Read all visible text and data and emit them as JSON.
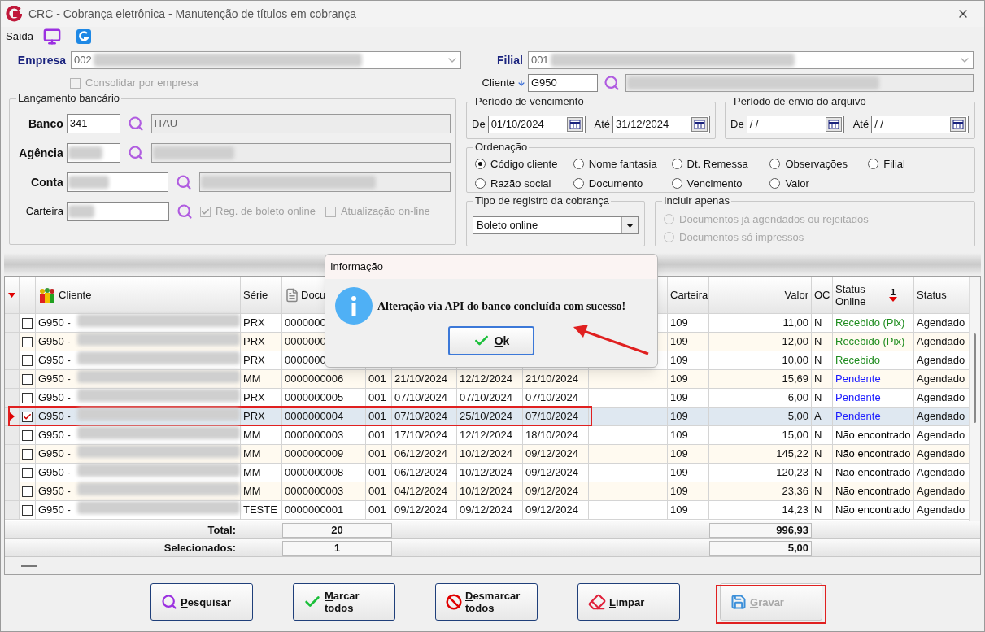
{
  "window": {
    "title": "CRC - Cobrança eletrônica - Manutenção de títulos em cobrança"
  },
  "menu": {
    "label": "Saída"
  },
  "empresa": {
    "label": "Empresa",
    "value": "002"
  },
  "consolidar": {
    "label": "Consolidar por empresa",
    "checked": false,
    "disabled": true
  },
  "filial": {
    "label": "Filial",
    "value": "001"
  },
  "cliente": {
    "label": "Cliente",
    "value": "G950"
  },
  "lancamento": {
    "title": "Lançamento bancário",
    "banco": {
      "label": "Banco",
      "value": "341",
      "name": "ITAU"
    },
    "agencia": {
      "label": "Agência"
    },
    "conta": {
      "label": "Conta"
    },
    "carteira": {
      "label": "Carteira"
    },
    "options": [
      {
        "label": "Reg. de boleto online",
        "checked": true,
        "disabled": true
      },
      {
        "label": "Atualização on-line",
        "checked": false,
        "disabled": true
      }
    ]
  },
  "vencimento": {
    "title": "Período de vencimento",
    "from_label": "De",
    "from": "01/10/2024",
    "to_label": "Até",
    "to": "31/12/2024"
  },
  "envio": {
    "title": "Período de envio do arquivo",
    "from_label": "De",
    "from": "/ /",
    "to_label": "Até",
    "to": "/ /"
  },
  "ordenacao": {
    "title": "Ordenação",
    "options": [
      {
        "label": "Código cliente",
        "selected": true
      },
      {
        "label": "Nome fantasia",
        "selected": false
      },
      {
        "label": "Dt. Remessa",
        "selected": false
      },
      {
        "label": "Observações",
        "selected": false
      },
      {
        "label": "Filial",
        "selected": false
      },
      {
        "label": "Razão social",
        "selected": false
      },
      {
        "label": "Documento",
        "selected": false
      },
      {
        "label": "Vencimento",
        "selected": false
      },
      {
        "label": "Valor",
        "selected": false
      }
    ]
  },
  "tipo_registro": {
    "title": "Tipo de registro da cobrança",
    "value": "Boleto online"
  },
  "incluir": {
    "title": "Incluir apenas",
    "options": [
      {
        "label": "Documentos já agendados ou rejeitados",
        "selected": false,
        "disabled": true
      },
      {
        "label": "Documentos só impressos",
        "selected": false,
        "disabled": true
      }
    ]
  },
  "table": {
    "columns": [
      {
        "label": "Cliente"
      },
      {
        "label": "Série"
      },
      {
        "label": "Docu"
      },
      {},
      {},
      {},
      {},
      {},
      {
        "label": "Carteira"
      },
      {
        "label": "Valor"
      },
      {
        "label": "OC"
      },
      {
        "label": "Status Online",
        "sort_order": "1"
      },
      {
        "label": "Status"
      }
    ],
    "rows": [
      {
        "checked": false,
        "selected": false,
        "cliente": "G950 -",
        "serie": "PRX",
        "documento": "0000000",
        "carteira": "109",
        "valor": "11,00",
        "oc": "N",
        "status_online": "Recebido (Pix)",
        "color": "#1e8c1e",
        "status": "Agendado"
      },
      {
        "checked": false,
        "selected": false,
        "cliente": "G950 -",
        "serie": "PRX",
        "documento": "0000000",
        "carteira": "109",
        "valor": "12,00",
        "oc": "N",
        "status_online": "Recebido (Pix)",
        "color": "#1e8c1e",
        "status": "Agendado"
      },
      {
        "checked": false,
        "selected": false,
        "cliente": "G950 -",
        "serie": "PRX",
        "documento": "0000000",
        "carteira": "109",
        "valor": "10,00",
        "oc": "N",
        "status_online": "Recebido",
        "color": "#1e8c1e",
        "status": "Agendado"
      },
      {
        "checked": false,
        "selected": false,
        "cliente": "G950 -",
        "serie": "MM",
        "documento": "0000000006",
        "column_6": "001",
        "column_7": "21/10/2024",
        "column_8": "12/12/2024",
        "column_9": "21/10/2024",
        "carteira": "109",
        "valor": "15,69",
        "oc": "N",
        "status_online": "Pendente",
        "color": "#1a1aff",
        "status": "Agendado"
      },
      {
        "checked": false,
        "selected": false,
        "cliente": "G950 -",
        "serie": "PRX",
        "documento": "0000000005",
        "column_6": "001",
        "column_7": "07/10/2024",
        "column_8": "07/10/2024",
        "column_9": "07/10/2024",
        "carteira": "109",
        "valor": "6,00",
        "oc": "N",
        "status_online": "Pendente",
        "color": "#1a1aff",
        "status": "Agendado"
      },
      {
        "checked": true,
        "selected": true,
        "cliente": "G950 -",
        "serie": "PRX",
        "documento": "0000000004",
        "column_6": "001",
        "column_7": "07/10/2024",
        "column_8": "25/10/2024",
        "column_9": "07/10/2024",
        "carteira": "109",
        "valor": "5,00",
        "oc": "A",
        "status_online": "Pendente",
        "color": "#1a1aff",
        "status": "Agendado"
      },
      {
        "checked": false,
        "selected": false,
        "cliente": "G950 -",
        "serie": "MM",
        "documento": "0000000003",
        "column_6": "001",
        "column_7": "17/10/2024",
        "column_8": "12/12/2024",
        "column_9": "18/10/2024",
        "carteira": "109",
        "valor": "15,00",
        "oc": "N",
        "status_online": "Não encontrado",
        "color": "#000000",
        "status": "Agendado"
      },
      {
        "checked": false,
        "selected": false,
        "cliente": "G950 -",
        "serie": "MM",
        "documento": "0000000009",
        "column_6": "001",
        "column_7": "06/12/2024",
        "column_8": "10/12/2024",
        "column_9": "09/12/2024",
        "carteira": "109",
        "valor": "145,22",
        "oc": "N",
        "status_online": "Não encontrado",
        "color": "#000000",
        "status": "Agendado"
      },
      {
        "checked": false,
        "selected": false,
        "cliente": "G950 -",
        "serie": "MM",
        "documento": "0000000008",
        "column_6": "001",
        "column_7": "06/12/2024",
        "column_8": "10/12/2024",
        "column_9": "09/12/2024",
        "carteira": "109",
        "valor": "120,23",
        "oc": "N",
        "status_online": "Não encontrado",
        "color": "#000000",
        "status": "Agendado"
      },
      {
        "checked": false,
        "selected": false,
        "cliente": "G950 -",
        "serie": "MM",
        "documento": "0000000003",
        "column_6": "001",
        "column_7": "04/12/2024",
        "column_8": "10/12/2024",
        "column_9": "09/12/2024",
        "carteira": "109",
        "valor": "23,36",
        "oc": "N",
        "status_online": "Não encontrado",
        "color": "#000000",
        "status": "Agendado"
      },
      {
        "checked": false,
        "selected": false,
        "cliente": "G950 -",
        "serie": "TESTE",
        "documento": "0000000001",
        "column_6": "001",
        "column_7": "09/12/2024",
        "column_8": "09/12/2024",
        "column_9": "09/12/2024",
        "carteira": "109",
        "valor": "14,23",
        "oc": "N",
        "status_online": "Não encontrado",
        "color": "#000000",
        "status": "Agendado"
      }
    ]
  },
  "totals": [
    {
      "label": "Total:",
      "count": "20",
      "value": "996,93"
    },
    {
      "label": "Selecionados:",
      "count": "1",
      "value": "5,00"
    }
  ],
  "buttons": [
    {
      "label": "Pesquisar",
      "kind": "search",
      "disabled": false
    },
    {
      "label": "Marcar todos",
      "kind": "check",
      "disabled": false
    },
    {
      "label": "Desmarcar todos",
      "kind": "uncheck",
      "disabled": false
    },
    {
      "label": "Limpar",
      "kind": "clear",
      "disabled": false
    },
    {
      "label": "Gravar",
      "kind": "save",
      "disabled": true
    }
  ],
  "dialog": {
    "title": "Informação",
    "message": "Alteração via API do banco concluída com sucesso!",
    "button": "Ok"
  }
}
